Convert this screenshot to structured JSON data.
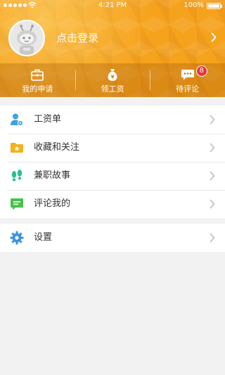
{
  "status_bar": {
    "time": "4:21 PM",
    "battery_percent": "100%",
    "battery_level": 1.0
  },
  "profile": {
    "login_label": "点击登录",
    "avatar_icon": "robot-avatar-icon",
    "chevron_icon": "chevron-right-icon"
  },
  "actions": [
    {
      "label": "我的申请",
      "icon": "briefcase-icon"
    },
    {
      "label": "领工资",
      "icon": "money-bag-icon"
    },
    {
      "label": "待评论",
      "icon": "chat-bubble-icon",
      "badge": "8"
    }
  ],
  "menu_group_1": [
    {
      "label": "工资单",
      "icon": "user-settings-icon",
      "color": "#3aa3e3"
    },
    {
      "label": "收藏和关注",
      "icon": "folder-star-icon",
      "color": "#f5b21d"
    },
    {
      "label": "兼职故事",
      "icon": "footprints-icon",
      "color": "#2bbf8f"
    },
    {
      "label": "评论我的",
      "icon": "comment-icon",
      "color": "#45c34a"
    }
  ],
  "menu_group_2": [
    {
      "label": "设置",
      "icon": "gear-icon",
      "color": "#3a93dc"
    }
  ],
  "colors": {
    "header_orange": "#f5a21d",
    "badge_red": "#e8353a",
    "background": "#f2f2f2"
  }
}
